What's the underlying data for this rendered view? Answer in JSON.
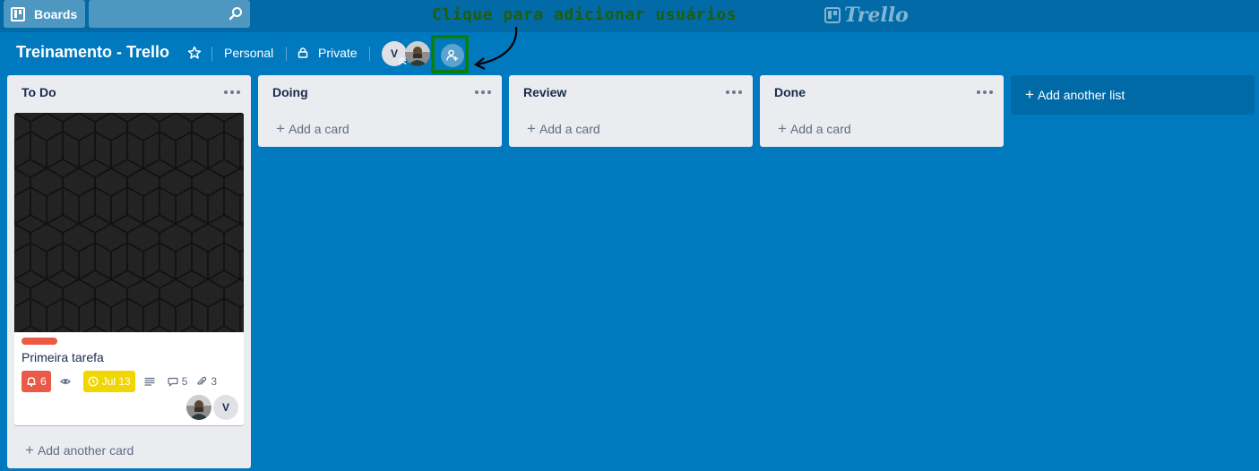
{
  "topbar": {
    "boards_label": "Boards",
    "search_value": "",
    "logo_text": "Trello"
  },
  "annotation": {
    "text": "Clique para adicionar usuários",
    "color": "#1e5e0c"
  },
  "board": {
    "title": "Treinamento - Trello",
    "team": "Personal",
    "visibility": "Private",
    "members": [
      {
        "initial": "V"
      },
      {
        "initial": ""
      }
    ],
    "background": "#0079bf"
  },
  "lists": [
    {
      "title": "To Do",
      "cards": [
        {
          "label_color": "#eb5a46",
          "title": "Primeira tarefa",
          "badges": {
            "notifications": "6",
            "due": "Jul 13",
            "comments": "5",
            "attachments": "3"
          },
          "members": [
            {
              "initial": ""
            },
            {
              "initial": "V"
            }
          ]
        }
      ],
      "add_label": "Add another card"
    },
    {
      "title": "Doing",
      "add_label": "Add a card"
    },
    {
      "title": "Review",
      "add_label": "Add a card"
    },
    {
      "title": "Done",
      "add_label": "Add a card"
    }
  ],
  "add_list_label": "Add another list"
}
